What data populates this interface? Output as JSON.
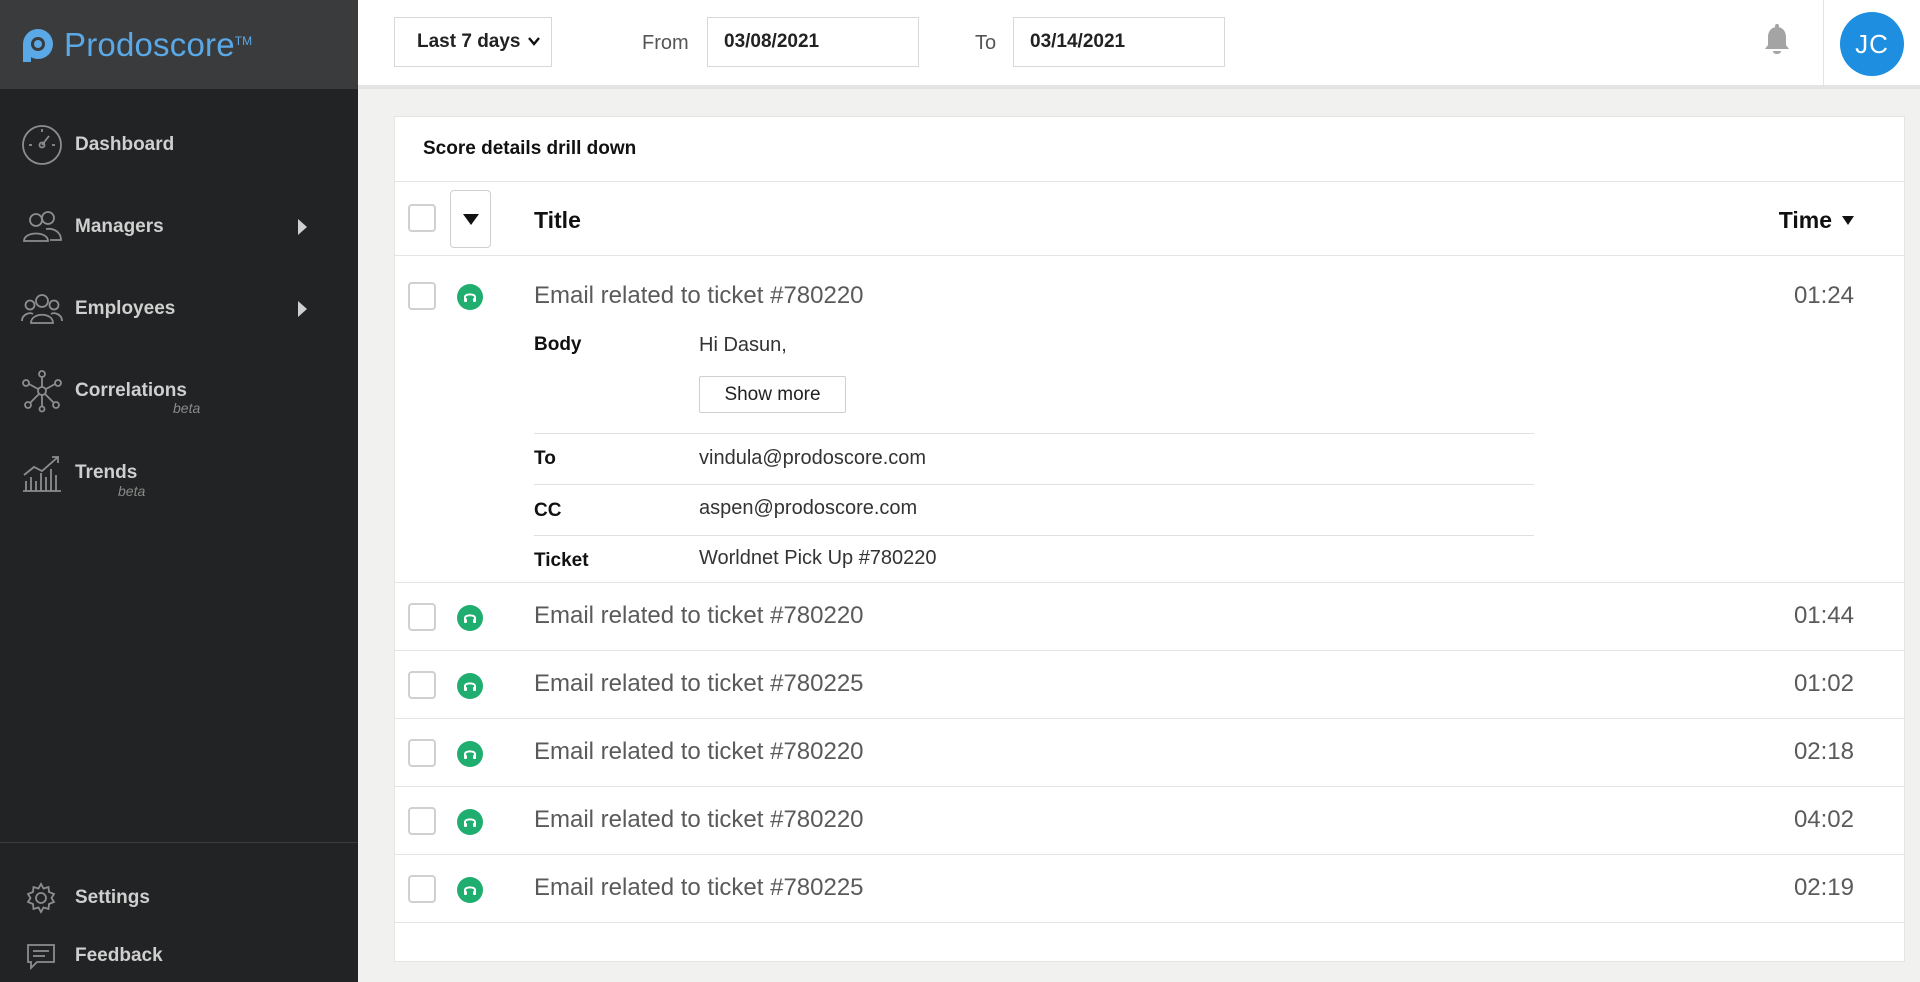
{
  "app": {
    "brand_name": "Prodoscore",
    "brand_tm": "TM"
  },
  "sidebar": {
    "items": [
      {
        "label": "Dashboard",
        "icon": "speedometer-icon"
      },
      {
        "label": "Managers",
        "icon": "managers-icon",
        "has_submenu": true
      },
      {
        "label": "Employees",
        "icon": "employees-icon",
        "has_submenu": true
      },
      {
        "label": "Correlations",
        "icon": "correlations-icon",
        "beta": "beta"
      },
      {
        "label": "Trends",
        "icon": "trends-icon",
        "beta": "beta"
      }
    ],
    "bottom_items": [
      {
        "label": "Settings",
        "icon": "gear-icon"
      },
      {
        "label": "Feedback",
        "icon": "feedback-icon"
      }
    ]
  },
  "topbar": {
    "range_select": "Last 7 days",
    "from_label": "From",
    "from_value": "03/08/2021",
    "to_label": "To",
    "to_value": "03/14/2021",
    "avatar_initials": "JC",
    "avatar_color": "#1e8ee0"
  },
  "card": {
    "title": "Score details drill down",
    "columns": {
      "title": "Title",
      "time": "Time"
    },
    "rows": [
      {
        "title": "Email related to ticket #780220",
        "time": "01:24",
        "expanded": true,
        "details": {
          "body_label": "Body",
          "body_value": "Hi Dasun,",
          "show_more_label": "Show more",
          "to_label": "To",
          "to_value": "vindula@prodoscore.com",
          "cc_label": "CC",
          "cc_value": "aspen@prodoscore.com",
          "ticket_label": "Ticket",
          "ticket_value": "Worldnet Pick Up #780220"
        }
      },
      {
        "title": "Email related to ticket #780220",
        "time": "01:44"
      },
      {
        "title": "Email related to ticket #780225",
        "time": "01:02"
      },
      {
        "title": "Email related to ticket #780220",
        "time": "02:18"
      },
      {
        "title": "Email related to ticket #780220",
        "time": "04:02"
      },
      {
        "title": "Email related to ticket #780225",
        "time": "02:19"
      }
    ]
  },
  "colors": {
    "sidebar_bg": "#222324",
    "brand_bg": "#3a3b3c",
    "accent_blue": "#5ba8e6",
    "row_icon_green": "#1fae70"
  }
}
